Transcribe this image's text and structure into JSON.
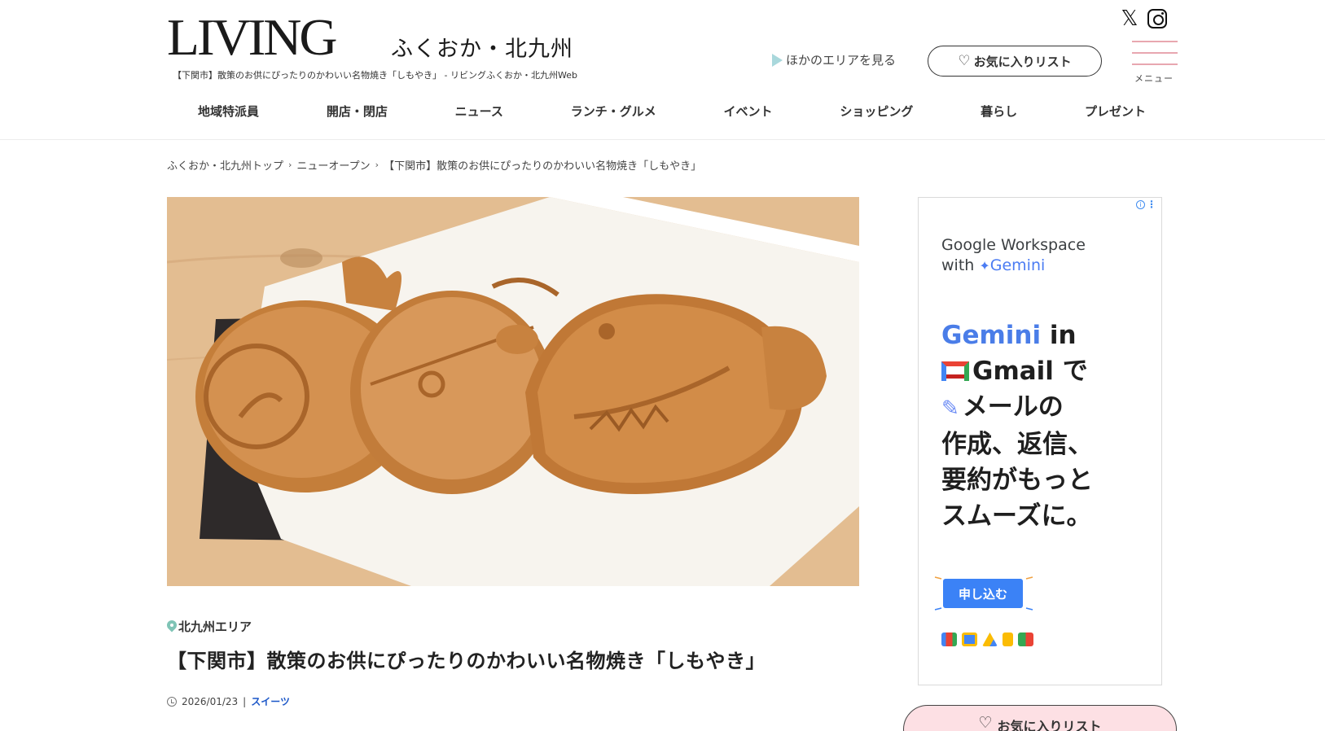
{
  "header": {
    "logo": "LIVING",
    "logo_sub": "ふくおか・北九州",
    "tagline": "【下関市】散策のお供にぴったりのかわいい名物焼き「しもやき」 - リビングふくおか・北九州Web",
    "other_area": "ほかのエリアを見る",
    "favorites": "お気に入りリスト",
    "menu_label": "メニュー",
    "x_glyph": "𝕏"
  },
  "nav": {
    "items": [
      "地域特派員",
      "開店・閉店",
      "ニュース",
      "ランチ・グルメ",
      "イベント",
      "ショッピング",
      "暮らし",
      "プレゼント"
    ]
  },
  "breadcrumb": {
    "items": [
      "ふくおか・北九州トップ",
      "ニューオープン",
      "【下関市】散策のお供にぴったりのかわいい名物焼き「しもやき」"
    ],
    "sep": "›"
  },
  "article": {
    "area": "北九州エリア",
    "title": "【下関市】散策のお供にぴったりのかわいい名物焼き「しもやき」",
    "date": "2026/01/23",
    "sep": "|",
    "category": "スイーツ"
  },
  "ad": {
    "brand_line1": "Google Workspace",
    "brand_with": "with",
    "brand_gemini": "Gemini",
    "head_gemini": "Gemini",
    "head_in": " in",
    "head_gmail": "Gmail で",
    "head_line3": "メールの",
    "head_line4": "作成、返信、",
    "head_line5": "要約がもっと",
    "head_line6": "スムーズに。",
    "cta": "申し込む",
    "info": "i",
    "more": "⋮"
  },
  "fav_bottom": {
    "label": "お気に入りリスト"
  },
  "colors": {
    "menu_lines": "#e8a7b0",
    "pin": "#7fc4b6",
    "category_link": "#1a56c8",
    "ad_cta": "#3b82f6",
    "fav_bottom_bg": "#fde0e4"
  }
}
